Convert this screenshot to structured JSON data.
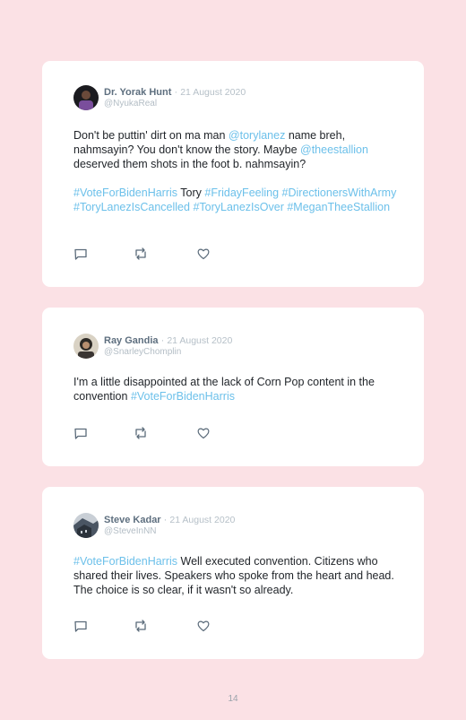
{
  "page_number": "14",
  "tweets": [
    {
      "name": "Dr. Yorak Hunt",
      "separator": "·",
      "date": "21 August 2020",
      "handle": "@NyukaReal",
      "avatar": "avatar-dark-portrait",
      "paragraphs": [
        [
          {
            "t": "Don't be puttin' dirt on ma man ",
            "link": false
          },
          {
            "t": "@torylanez",
            "link": true
          },
          {
            "t": " name breh, nahmsayin? You don't know the story. Maybe ",
            "link": false
          },
          {
            "t": "@theestallion",
            "link": true
          },
          {
            "t": " deserved them shots in the foot b. nahmsayin?",
            "link": false
          }
        ],
        [
          {
            "t": "#VoteForBidenHarris",
            "link": true
          },
          {
            "t": " Tory ",
            "link": false
          },
          {
            "t": "#FridayFeeling",
            "link": true
          },
          {
            "t": " ",
            "link": false
          },
          {
            "t": "#DirectionersWithArmy",
            "link": true
          },
          {
            "t": " ",
            "link": false
          },
          {
            "t": "#ToryLanezIsCancelled",
            "link": true
          },
          {
            "t": " ",
            "link": false
          },
          {
            "t": "#ToryLanezIsOver",
            "link": true
          },
          {
            "t": " ",
            "link": false
          },
          {
            "t": "#MeganTheeStallion",
            "link": true
          }
        ]
      ],
      "actions": [
        "reply-icon",
        "retweet-icon",
        "like-icon"
      ]
    },
    {
      "name": "Ray Gandia",
      "separator": "·",
      "date": "21 August 2020",
      "handle": "@SnarleyChomplin",
      "avatar": "avatar-portrait",
      "paragraphs": [
        [
          {
            "t": "I'm a little disappointed at the lack of Corn Pop content in the convention ",
            "link": false
          },
          {
            "t": "#VoteForBidenHarris",
            "link": true
          }
        ]
      ],
      "actions": [
        "reply-icon",
        "retweet-icon",
        "like-icon"
      ]
    },
    {
      "name": "Steve Kadar",
      "separator": "·",
      "date": "21 August 2020",
      "handle": "@SteveInNN",
      "avatar": "avatar-building",
      "paragraphs": [
        [
          {
            "t": "#VoteForBidenHarris",
            "link": true
          },
          {
            "t": " Well executed convention. Citizens who shared their lives. Speakers who spoke from the heart and head. The choice is so clear, if it wasn't so already.",
            "link": false
          }
        ]
      ],
      "actions": [
        "reply-icon",
        "retweet-icon",
        "like-icon"
      ]
    }
  ],
  "colors": {
    "background": "#fbe1e5",
    "card": "#ffffff",
    "link": "#6cc0ea",
    "name": "#5e6f7f",
    "muted": "#b6c0c8",
    "text": "#1f2328"
  }
}
